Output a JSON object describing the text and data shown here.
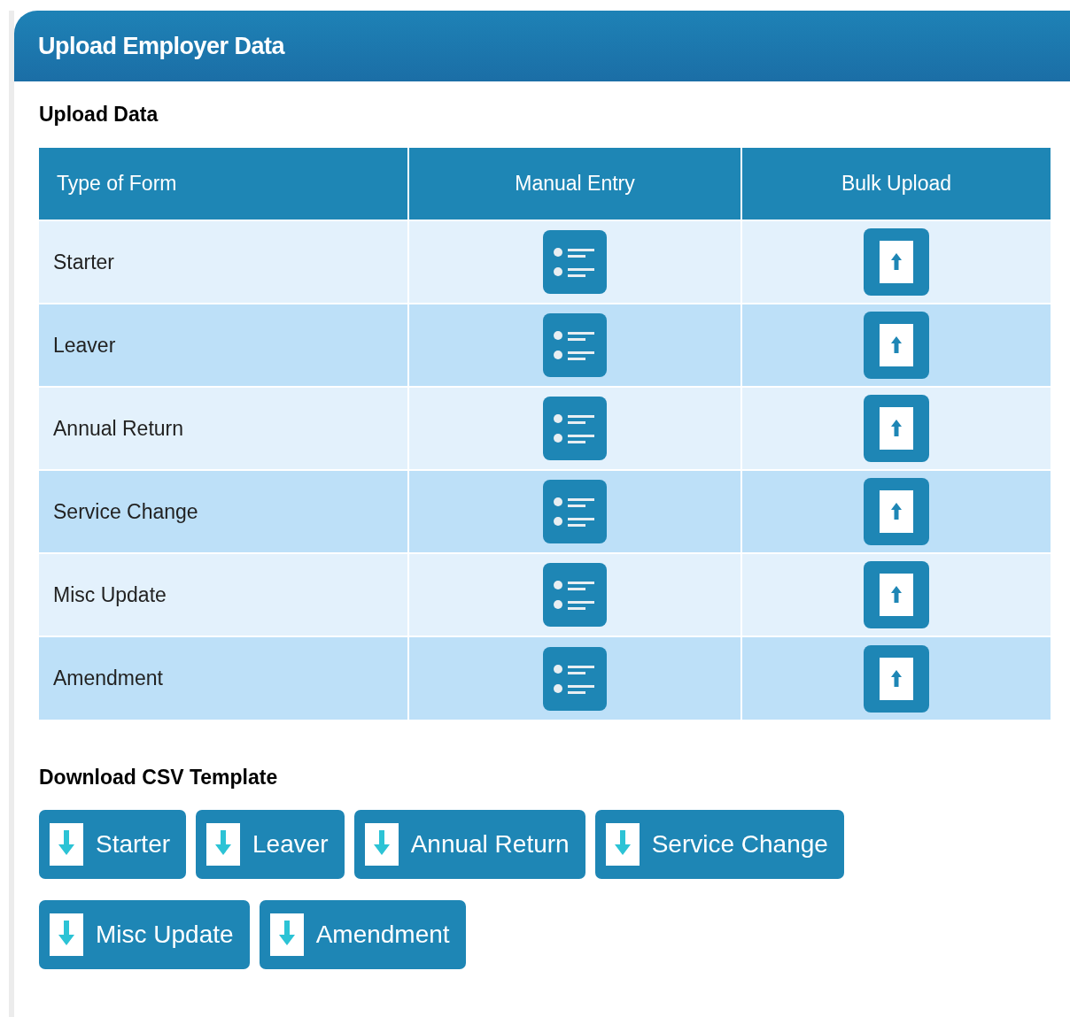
{
  "panel": {
    "title": "Upload Employer Data"
  },
  "upload": {
    "heading": "Upload Data",
    "table": {
      "columns": [
        "Type of Form",
        "Manual Entry",
        "Bulk Upload"
      ],
      "rows": [
        {
          "form": "Starter"
        },
        {
          "form": "Leaver"
        },
        {
          "form": "Annual Return"
        },
        {
          "form": "Service Change"
        },
        {
          "form": "Misc Update"
        },
        {
          "form": "Amendment"
        }
      ]
    }
  },
  "download": {
    "heading": "Download CSV Template",
    "buttons": [
      [
        "Starter",
        "Leaver",
        "Annual Return",
        "Service Change"
      ],
      [
        "Misc Update",
        "Amendment"
      ]
    ]
  }
}
